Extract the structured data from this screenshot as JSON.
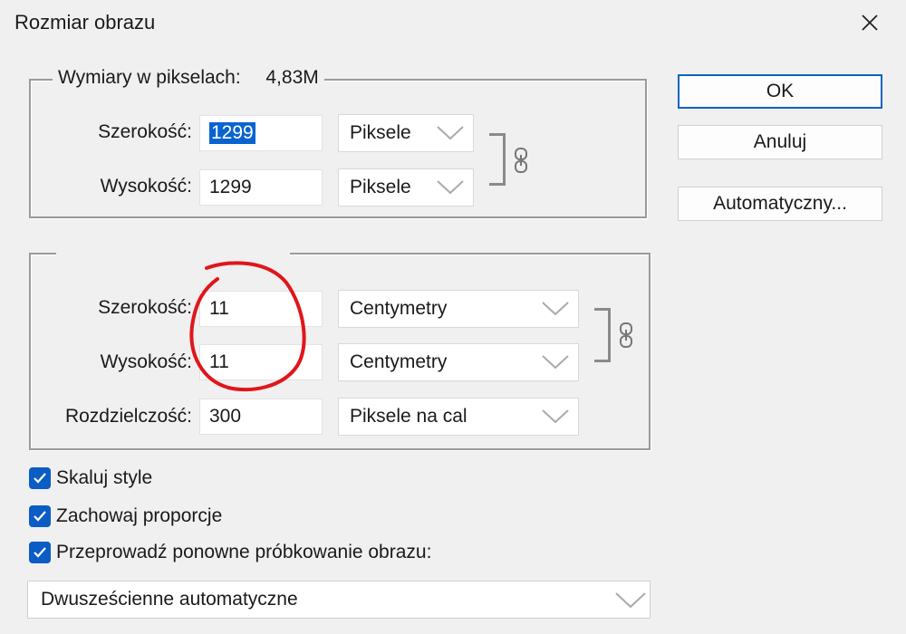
{
  "window": {
    "title": "Rozmiar obrazu"
  },
  "pixel_dimensions": {
    "legend": "Wymiary w pikselach:",
    "total": "4,83M",
    "width_label": "Szerokość:",
    "width_value": "1299",
    "width_unit": "Piksele",
    "height_label": "Wysokość:",
    "height_value": "1299",
    "height_unit": "Piksele"
  },
  "document_size": {
    "width_label": "Szerokość:",
    "width_value": "11",
    "width_unit": "Centymetry",
    "height_label": "Wysokość:",
    "height_value": "11",
    "height_unit": "Centymetry",
    "resolution_label": "Rozdzielczość:",
    "resolution_value": "300",
    "resolution_unit": "Piksele na cal"
  },
  "buttons": {
    "ok": "OK",
    "cancel": "Anuluj",
    "auto": "Automatyczny..."
  },
  "options": {
    "scale_styles": "Skaluj style",
    "constrain": "Zachowaj proporcje",
    "resample": "Przeprowadź ponowne próbkowanie obrazu:",
    "resample_method": "Dwusześcienne automatyczne"
  },
  "colors": {
    "accent": "#0b5cc4",
    "annotation": "#e0161b",
    "selection": "#0a64d0"
  }
}
